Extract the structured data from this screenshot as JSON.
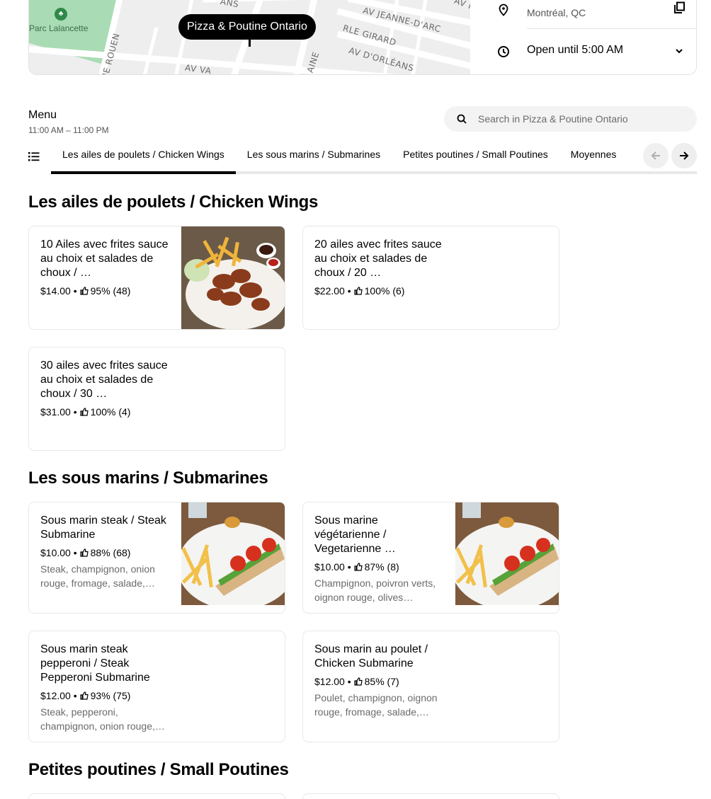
{
  "store": {
    "name": "Pizza & Poutine Ontario",
    "city": "Montréal, QC",
    "hours_status": "Open until 5:00 AM"
  },
  "map": {
    "park_label": "Parc Lalancette",
    "streets": [
      "AV JEANNE-D'ARC",
      "RLE GIRARD",
      "AV D'ORLÉANS",
      "AV VA",
      "RUE ROUEN",
      "AINE",
      "ANS",
      "AV PI"
    ]
  },
  "menu": {
    "title": "Menu",
    "hours": "11:00 AM – 11:00 PM",
    "search_placeholder": "Search in Pizza & Poutine Ontario",
    "tabs": [
      "Les ailes de poulets / Chicken Wings",
      "Les sous marins / Submarines",
      "Petites poutines / Small Poutines",
      "Moyennes"
    ],
    "active_tab": 0
  },
  "sections": [
    {
      "title": "Les ailes de poulets / Chicken Wings",
      "items": [
        {
          "name": "10 Ailes avec frites sauce au choix et salades de choux / …",
          "price": "$14.00",
          "rating": "95% (48)",
          "description": "",
          "photo": "wings"
        },
        {
          "name": "20 ailes avec frites sauce au choix et salades de choux / 20 …",
          "price": "$22.00",
          "rating": "100% (6)",
          "description": "",
          "photo": ""
        },
        {
          "name": "30 ailes avec frites sauce au choix et salades de choux / 30 …",
          "price": "$31.00",
          "rating": "100% (4)",
          "description": "",
          "photo": ""
        }
      ]
    },
    {
      "title": "Les sous marins / Submarines",
      "items": [
        {
          "name": "Sous marin steak / Steak Submarine",
          "price": "$10.00",
          "rating": "88% (68)",
          "description": "Steak, champignon, onion rouge, fromage, salade,…",
          "photo": "sub"
        },
        {
          "name": "Sous marine végétarienne / Vegetarienne …",
          "price": "$10.00",
          "rating": "87% (8)",
          "description": "Champignon, poivron verts, oignon rouge, olives noires,…",
          "photo": "sub"
        },
        {
          "name": "Sous marin steak pepperoni / Steak Pepperoni Submarine",
          "price": "$12.00",
          "rating": "93% (75)",
          "description": "Steak, pepperoni, champignon, onion rouge,…",
          "photo": ""
        },
        {
          "name": "Sous marin au poulet / Chicken Submarine",
          "price": "$12.00",
          "rating": "85% (7)",
          "description": "Poulet, champignon, oignon rouge, fromage, salade,…",
          "photo": ""
        }
      ]
    },
    {
      "title": "Petites poutines / Small Poutines",
      "items": []
    }
  ],
  "icons": {
    "location": "map-pin-icon",
    "copy": "copy-icon",
    "clock": "clock-icon",
    "chevron": "chevron-down-icon",
    "search": "search-icon",
    "list": "list-icon",
    "prev": "arrow-left-icon",
    "next": "arrow-right-icon",
    "thumb": "thumbs-up-icon"
  }
}
